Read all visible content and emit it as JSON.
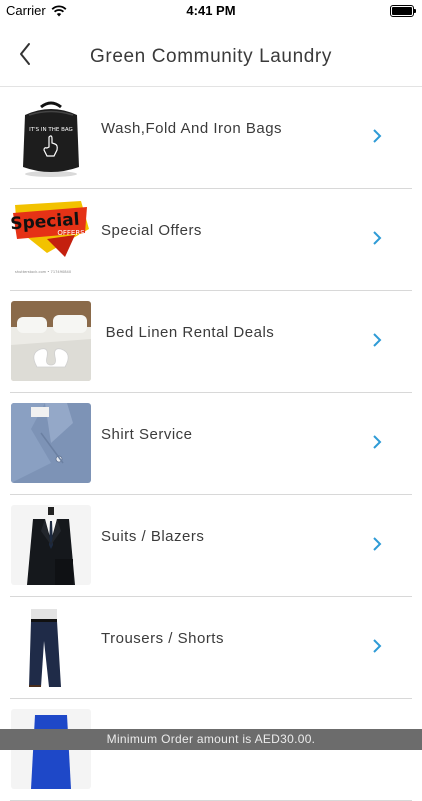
{
  "status_bar": {
    "carrier": "Carrier",
    "time": "4:41 PM"
  },
  "header": {
    "title": "Green Community Laundry"
  },
  "services": [
    {
      "label": "Wash,Fold And Iron Bags",
      "image": "laundry-bag-image",
      "bag_text": "IT'S IN THE BAG"
    },
    {
      "label": "Special Offers",
      "image": "special-offers-image",
      "promo_word": "Special",
      "promo_sub": "OFFERS",
      "credit": "shutterstock.com • 717490840"
    },
    {
      "label": " Bed Linen Rental Deals",
      "image": "bed-linen-image"
    },
    {
      "label": "Shirt Service",
      "image": "shirt-image"
    },
    {
      "label": "Suits / Blazers",
      "image": "suit-image"
    },
    {
      "label": "Trousers / Shorts",
      "image": "trousers-image"
    },
    {
      "label": "",
      "image": "dress-image"
    }
  ],
  "footer": {
    "text": "Minimum Order amount is AED30.00."
  },
  "colors": {
    "accent": "#2e9bd6",
    "divider": "#d8d8d8",
    "footer_bg": "#6c6c6c"
  }
}
